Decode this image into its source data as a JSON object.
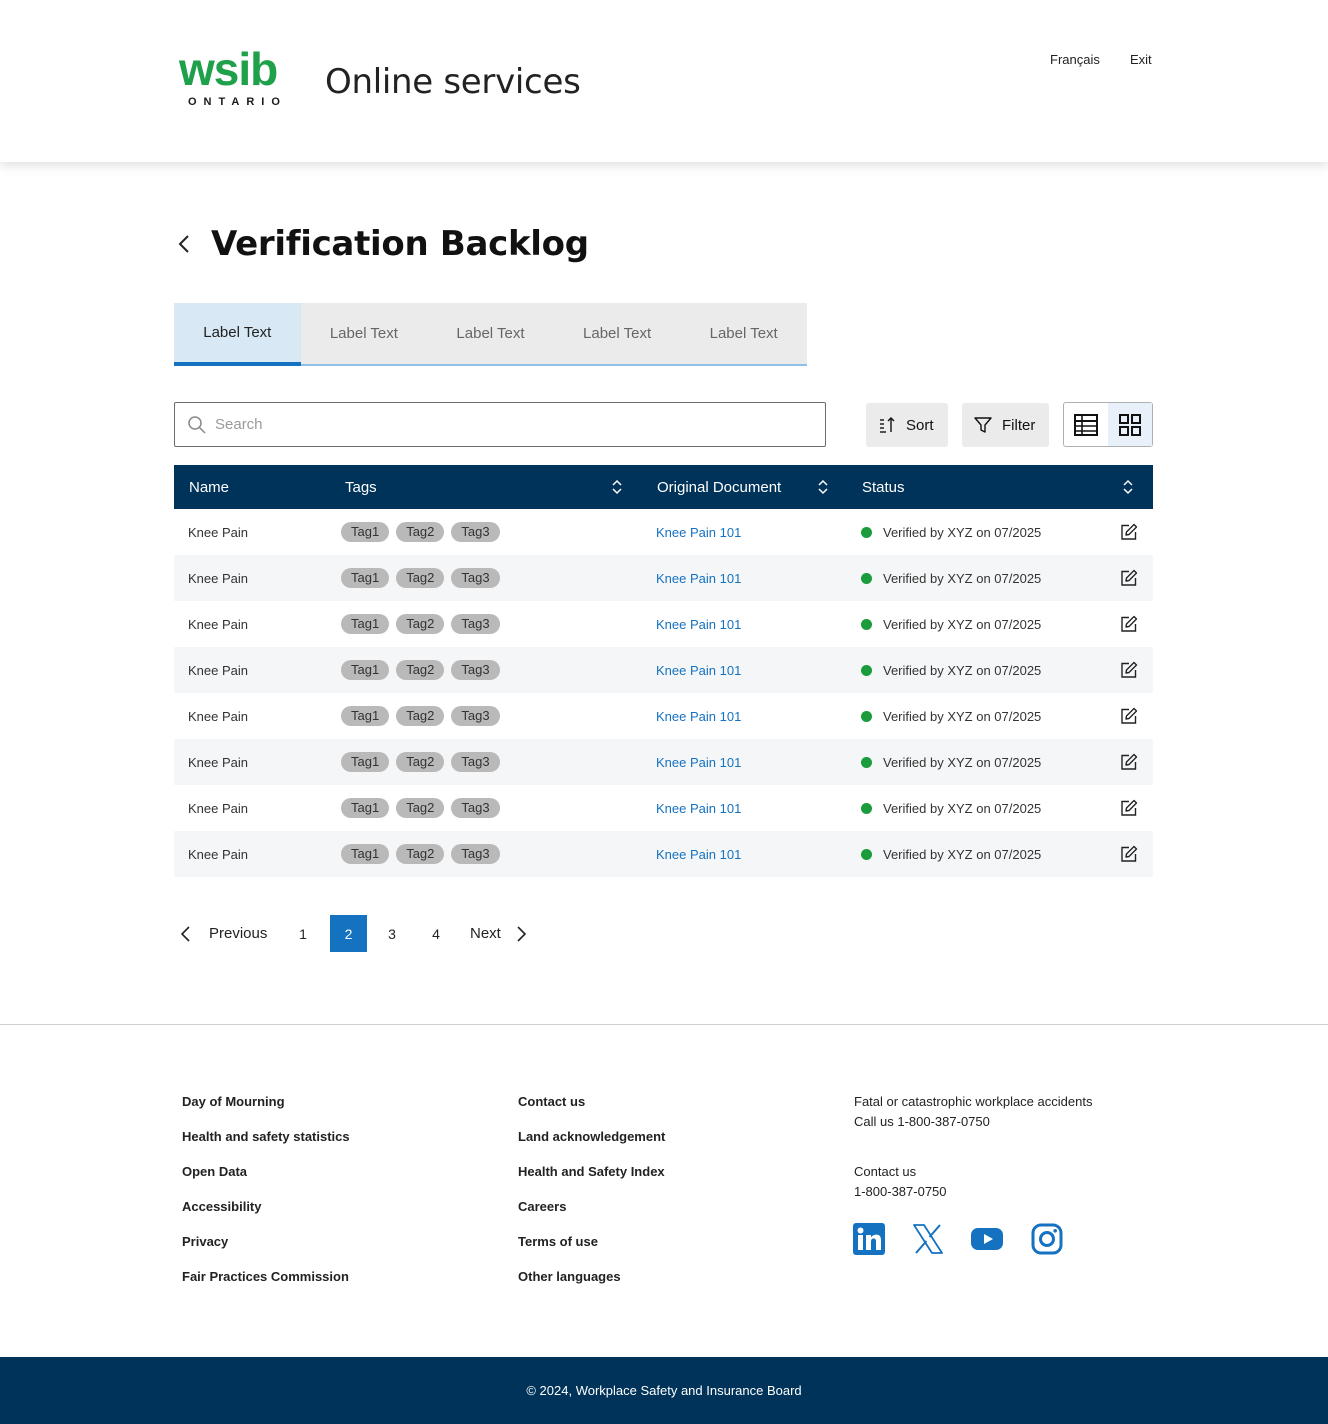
{
  "header": {
    "logo_word": "wsib",
    "logo_sub": "ONTARIO",
    "app_title": "Online services",
    "lang_link": "Français",
    "exit_link": "Exit"
  },
  "page": {
    "title": "Verification Backlog"
  },
  "tabs": [
    {
      "label": "Label Text",
      "active": true
    },
    {
      "label": "Label Text",
      "active": false
    },
    {
      "label": "Label Text",
      "active": false
    },
    {
      "label": "Label Text",
      "active": false
    },
    {
      "label": "Label Text",
      "active": false
    }
  ],
  "toolbar": {
    "search_placeholder": "Search",
    "sort_label": "Sort",
    "filter_label": "Filter",
    "active_view": "grid"
  },
  "table": {
    "columns": {
      "name": "Name",
      "tags": "Tags",
      "document": "Original Document",
      "status": "Status"
    },
    "rows": [
      {
        "name": "Knee Pain",
        "tags": [
          "Tag1",
          "Tag2",
          "Tag3"
        ],
        "document": "Knee Pain 101",
        "status": "Verified by XYZ on 07/2025"
      },
      {
        "name": "Knee Pain",
        "tags": [
          "Tag1",
          "Tag2",
          "Tag3"
        ],
        "document": "Knee Pain 101",
        "status": "Verified by XYZ on 07/2025"
      },
      {
        "name": "Knee Pain",
        "tags": [
          "Tag1",
          "Tag2",
          "Tag3"
        ],
        "document": "Knee Pain 101",
        "status": "Verified by XYZ on 07/2025"
      },
      {
        "name": "Knee Pain",
        "tags": [
          "Tag1",
          "Tag2",
          "Tag3"
        ],
        "document": "Knee Pain 101",
        "status": "Verified by XYZ on 07/2025"
      },
      {
        "name": "Knee Pain",
        "tags": [
          "Tag1",
          "Tag2",
          "Tag3"
        ],
        "document": "Knee Pain 101",
        "status": "Verified by XYZ on 07/2025"
      },
      {
        "name": "Knee Pain",
        "tags": [
          "Tag1",
          "Tag2",
          "Tag3"
        ],
        "document": "Knee Pain 101",
        "status": "Verified by XYZ on 07/2025"
      },
      {
        "name": "Knee Pain",
        "tags": [
          "Tag1",
          "Tag2",
          "Tag3"
        ],
        "document": "Knee Pain 101",
        "status": "Verified by XYZ on 07/2025"
      },
      {
        "name": "Knee Pain",
        "tags": [
          "Tag1",
          "Tag2",
          "Tag3"
        ],
        "document": "Knee Pain 101",
        "status": "Verified by XYZ on 07/2025"
      }
    ]
  },
  "pagination": {
    "previous": "Previous",
    "next": "Next",
    "pages": [
      "1",
      "2",
      "3",
      "4"
    ],
    "current": "2"
  },
  "footer": {
    "col1": [
      "Day of Mourning",
      "Health and safety statistics",
      "Open Data",
      "Accessibility",
      "Privacy",
      "Fair Practices Commission"
    ],
    "col2": [
      "Contact us",
      "Land acknowledgement",
      "Health and Safety Index",
      "Careers",
      "Terms of use",
      "Other languages"
    ],
    "emergency_label": "Fatal or catastrophic workplace accidents",
    "emergency_phone": "Call us 1-800-387-0750",
    "contact_label": "Contact us",
    "contact_phone": "1-800-387-0750",
    "social": [
      "linkedin-icon",
      "x-icon",
      "youtube-icon",
      "instagram-icon"
    ],
    "copyright": "© 2024, Workplace Safety and Insurance Board"
  },
  "colors": {
    "brand_green": "#1fa04a",
    "navy": "#003359",
    "accent_blue": "#1572c0",
    "status_green": "#1a9b3c"
  }
}
